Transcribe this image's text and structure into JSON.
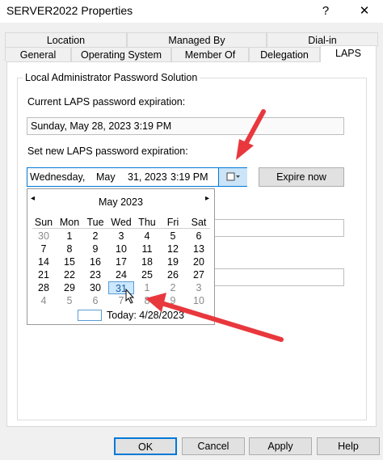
{
  "window": {
    "title": "SERVER2022 Properties",
    "help_glyph": "?",
    "close_glyph": "✕"
  },
  "tabs_row1": [
    "Location",
    "Managed By",
    "Dial-in"
  ],
  "tabs_row2": [
    "General",
    "Operating System",
    "Member Of",
    "Delegation",
    "LAPS"
  ],
  "laps": {
    "group_title": "Local Administrator Password Solution",
    "current_label": "Current LAPS password expiration:",
    "current_value": "Sunday, May 28, 2023 3:19 PM",
    "new_label": "Set new LAPS password expiration:",
    "new_value_day": "Wednesday,",
    "new_value_month": "May",
    "new_value_date": "31, 2023",
    "new_value_time": "3:19 PM",
    "expire_button": "Expire now"
  },
  "calendar": {
    "month_title": "May 2023",
    "prev_glyph": "◂",
    "next_glyph": "▸",
    "weekdays": [
      "Sun",
      "Mon",
      "Tue",
      "Wed",
      "Thu",
      "Fri",
      "Sat"
    ],
    "weeks": [
      [
        "30",
        "1",
        "2",
        "3",
        "4",
        "5",
        "6"
      ],
      [
        "7",
        "8",
        "9",
        "10",
        "11",
        "12",
        "13"
      ],
      [
        "14",
        "15",
        "16",
        "17",
        "18",
        "19",
        "20"
      ],
      [
        "21",
        "22",
        "23",
        "24",
        "25",
        "26",
        "27"
      ],
      [
        "28",
        "29",
        "30",
        "31",
        "1",
        "2",
        "3"
      ],
      [
        "4",
        "5",
        "6",
        "7",
        "8",
        "9",
        "10"
      ]
    ],
    "selected": "31",
    "today_label": "Today: 4/28/2023"
  },
  "buttons": {
    "ok": "OK",
    "cancel": "Cancel",
    "apply": "Apply",
    "help": "Help"
  },
  "colors": {
    "arrow": "#e8383d",
    "selected_day_bg": "#cce8ff",
    "selected_day_border": "#5b9bd5"
  }
}
